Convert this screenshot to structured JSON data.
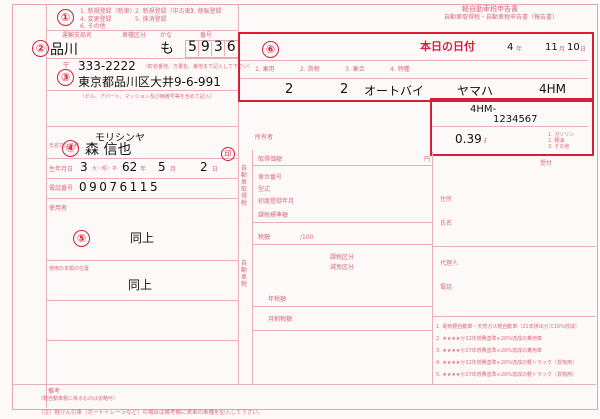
{
  "header": {
    "title_lines": [
      "軽自動車税申告書",
      "自動車取得税・自動車税申告書（報告書）"
    ]
  },
  "markers": [
    "①",
    "②",
    "③",
    "④",
    "⑤",
    "⑥"
  ],
  "section1": {
    "options": [
      "1. 新規登録（新車）",
      "2. 新規登録（中古車）",
      "3. 移転登録",
      "4. 変更登録",
      "5. 抹消登録",
      "6. その他"
    ]
  },
  "plate": {
    "labels": [
      "運輸支局名",
      "車種区分",
      "かな",
      "番号"
    ],
    "office": "品川",
    "kana": "も",
    "number": "5936"
  },
  "address": {
    "zip_label": "〒",
    "zip": "333-2222",
    "zip_note": "（町名番地、方書名、番地まで記入して下さい）",
    "line": "東京都品川区大井9-6-991",
    "building_note": "（ビル、アパート、マンション及び棟番号等を含めて記入）"
  },
  "owner": {
    "kana": "モリシンヤ",
    "name": "森 信也",
    "name_label": "氏名又は名称"
  },
  "birth": {
    "label": "生年月日",
    "era": "3",
    "year": "62",
    "month": "5",
    "day": "2",
    "unit_era": "大・昭・平",
    "unit_year": "年",
    "unit_month": "月",
    "unit_day": "日"
  },
  "phone": {
    "label": "電話番号",
    "value": "09076115"
  },
  "user": {
    "label": "使用者",
    "value": "同上"
  },
  "storage": {
    "label": "使用の本拠の位置",
    "value": "同上"
  },
  "vehicle": {
    "date_label": "本日の日付",
    "year": "4",
    "month": "11",
    "day": "10",
    "unit_year": "年",
    "unit_month": "月",
    "unit_day": "日",
    "code1": "2",
    "code2": "2",
    "type": "オートバイ",
    "maker": "ヤマハ",
    "model": "4HM",
    "serial_prefix": "4HM-",
    "serial": "1234567",
    "displacement": "0.39",
    "displacement_unit": "ℓ",
    "usage_labels": [
      "1. 乗用",
      "2. 貨物",
      "3. 乗合",
      "4. 特種"
    ],
    "fuel_labels": [
      "1. ガソリン",
      "2. 軽油",
      "3. その他"
    ]
  },
  "tax": {
    "section_labels": [
      "自動車取得税",
      "自動車税",
      "自動車税種別",
      "軽自動車税"
    ],
    "rows": [
      "取得価額",
      "課税標準額",
      "税額",
      "年税額",
      "月割税額"
    ],
    "unit": "円",
    "fraction": "/100",
    "misc_labels": [
      "車台番号",
      "型式",
      "初度登録年月",
      "所有者",
      "課税区分",
      "減免区分"
    ]
  },
  "right_panel": {
    "labels": [
      "住所",
      "氏名",
      "代理人",
      "電話",
      "受付"
    ],
    "checklist": [
      "1. 電気軽自動車・天然ガス軽自動車（21年排出ガス10%低減）",
      "2. ★★★★か32年燃費基準+20%達成の乗用車",
      "3. ★★★★か27年燃費基準+20%達成の乗用車",
      "4. ★★★★か32年燃費基準+20%達成の軽トラック（貨物用）",
      "5. ★★★★か27年燃費基準+20%達成の軽トラック（貨物用）"
    ]
  },
  "footer": {
    "remarks_label": "備考",
    "remarks_sub": "（軽自動車税に係るものは省略可）",
    "note": "（注）軽けん引車（ボートトレーラなど）の場合は備考欄に実車の車種を記入して下さい。"
  }
}
